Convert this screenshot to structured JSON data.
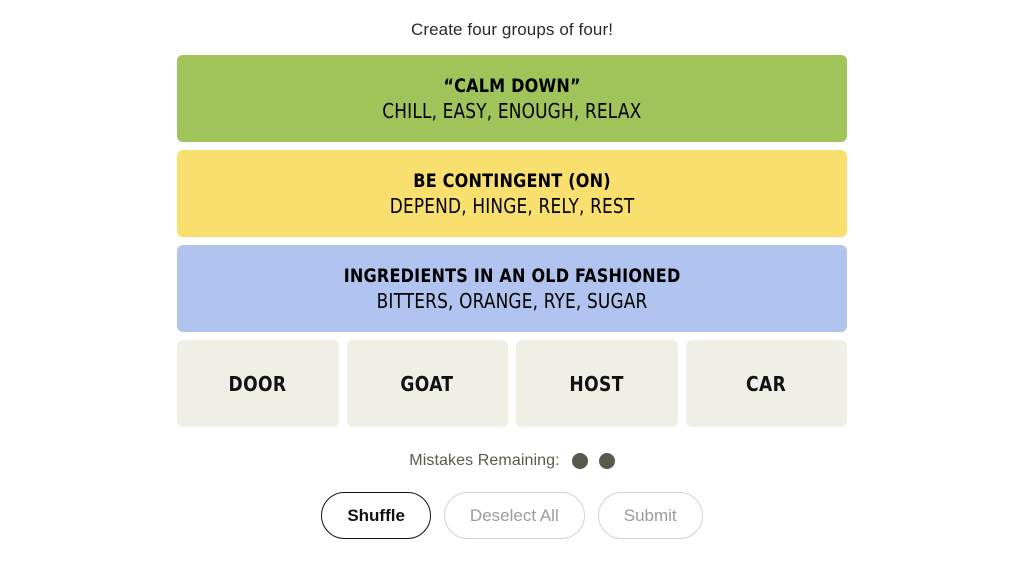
{
  "prompt": "Create four groups of four!",
  "solved_groups": [
    {
      "title": "“CALM DOWN”",
      "members": "CHILL, EASY, ENOUGH, RELAX",
      "color": "#a0c45a"
    },
    {
      "title": "BE CONTINGENT (ON)",
      "members": "DEPEND, HINGE, RELY, REST",
      "color": "#f9df6d"
    },
    {
      "title": "INGREDIENTS IN AN OLD FASHIONED",
      "members": "BITTERS, ORANGE, RYE, SUGAR",
      "color": "#b0c4ef"
    }
  ],
  "tiles": [
    {
      "label": "DOOR"
    },
    {
      "label": "GOAT"
    },
    {
      "label": "HOST"
    },
    {
      "label": "CAR"
    }
  ],
  "mistakes": {
    "label": "Mistakes Remaining:",
    "remaining": 2,
    "dot_color": "#5a594e"
  },
  "controls": {
    "shuffle_label": "Shuffle",
    "deselect_label": "Deselect All",
    "submit_label": "Submit"
  },
  "theme": {
    "background": "#ffffff",
    "tile_background": "#efefe6",
    "text": "#121212",
    "muted_text": "#5a594e",
    "disabled_text": "#9b9b9b"
  }
}
